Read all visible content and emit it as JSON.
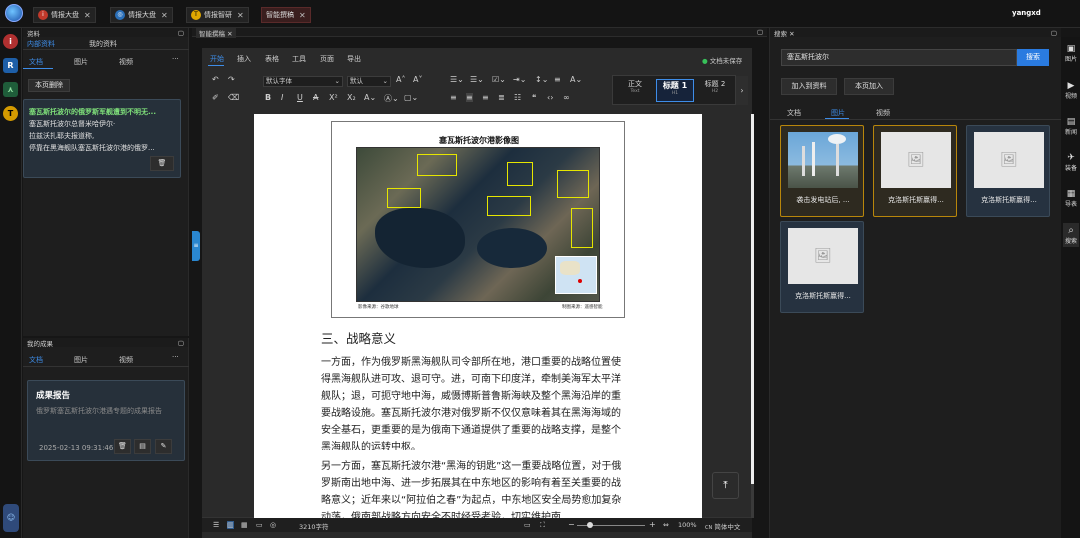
{
  "user": "yangxd",
  "tabs": [
    {
      "label": "情报大盘"
    },
    {
      "label": "情报大盘"
    },
    {
      "label": "情报智研"
    },
    {
      "label": "智能撰稿"
    }
  ],
  "left_panel": {
    "title": "资料",
    "subtabs": [
      "内部资料",
      "我的资料"
    ],
    "type_tabs": [
      "文档",
      "图片",
      "视频"
    ],
    "more": "···",
    "delete_page_btn": "本页删除",
    "note": {
      "title": "塞瓦斯托波尔的俄罗斯军舰遭到不明无...",
      "lines": [
        "塞瓦斯托波尔总督米哈伊尔·",
        "拉兹沃扎耶夫报道称,",
        "停靠在黑海舰队塞瓦斯托波尔港的俄罗..."
      ]
    }
  },
  "results_panel": {
    "title": "我的成果",
    "type_tabs": [
      "文档",
      "图片",
      "视频"
    ],
    "more": "···",
    "report": {
      "title": "成果报告",
      "desc": "俄罗斯塞瓦斯托波尔港遇专题的成果报告",
      "date": "2025-02-13 09:31:46"
    }
  },
  "editor": {
    "title": "智能撰稿",
    "ribbon": [
      "开始",
      "插入",
      "表格",
      "工具",
      "页面",
      "导出"
    ],
    "autosave": "文档未保存",
    "font": "默认字体",
    "size": "默认",
    "styles": [
      {
        "label": "正文",
        "sub": "Text"
      },
      {
        "label": "标题 1",
        "sub": "H1"
      },
      {
        "label": "标题 2",
        "sub": "H2"
      }
    ],
    "figure": {
      "title": "塞瓦斯托波尔港影像图",
      "source_left": "影像来源：谷歌地球",
      "source_right": "制图来源：遥感智能"
    },
    "heading": "三、战略意义",
    "paragraphs": [
      "一方面，作为俄罗斯黑海舰队司令部所在地，港口重要的战略位置使得黑海舰队进可攻、退可守。进，可南下印度洋，牵制美海军太平洋舰队；退，可扼守地中海，威慑博斯普鲁斯海峡及整个黑海沿岸的重要战略设施。塞瓦斯托波尔港对俄罗斯不仅仅意味着其在黑海海域的安全基石，更重要的是为俄南下通道提供了重要的战略支撑，是整个黑海舰队的运转中枢。",
      "另一方面，塞瓦斯托波尔港“黑海的钥匙”这一重要战略位置，对于俄罗斯南出地中海、进一步拓展其在中东地区的影响有着至关重要的战略意义；近年来以“阿拉伯之春”为起点，中东地区安全局势愈加复杂动荡，俄南部战略方向安全不时经受考验，切实维护南"
    ],
    "status": {
      "chars": "3210字符",
      "zoom": "100%",
      "lang": "简体中文"
    }
  },
  "right_panel": {
    "title": "搜索",
    "search_value": "塞瓦斯托波尔",
    "search_btn": "搜索",
    "add_btn": "加入到资料",
    "page_add_btn": "本页加入",
    "type_tabs": [
      "文档",
      "图片",
      "视频"
    ],
    "results": [
      {
        "caption": "袭击发电站后, ..."
      },
      {
        "caption": "克洛斯托斯赢得..."
      },
      {
        "caption": "克洛斯托斯赢得..."
      },
      {
        "caption": "克洛斯托斯赢得..."
      }
    ]
  },
  "side_nav": [
    "图片",
    "视频",
    "新闻",
    "装备",
    "导表",
    "搜索"
  ]
}
